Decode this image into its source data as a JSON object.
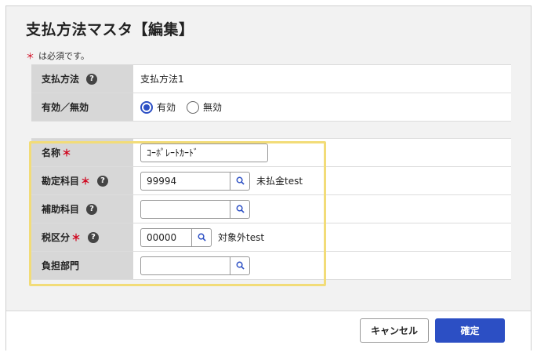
{
  "dialog": {
    "title": "支払方法マスタ【編集】",
    "required_note_star": "＊",
    "required_note_text": "は必須です。"
  },
  "basic": {
    "payment_method_label": "支払方法",
    "payment_method_value": "支払方法1",
    "active_label": "有効／無効",
    "active_options": [
      "有効",
      "無効"
    ],
    "active_selected": "有効"
  },
  "form": {
    "name_label": "名称",
    "name_value": "ｺｰﾎﾟﾚｰﾄｶｰﾄﾞ",
    "account_label": "勘定科目",
    "account_code": "99994",
    "account_name": "未払金test",
    "sub_account_label": "補助科目",
    "sub_account_value": "",
    "tax_label": "税区分",
    "tax_code": "00000",
    "tax_name": "対象外test",
    "department_label": "負担部門",
    "department_value": ""
  },
  "required_star": "＊",
  "help_glyph": "?",
  "icons": {
    "help": "question-circle-icon",
    "search": "search-icon"
  },
  "colors": {
    "accent": "#2c4fc4",
    "required": "#d0021b",
    "highlight": "#f2dc78"
  },
  "footer": {
    "cancel_label": "キャンセル",
    "confirm_label": "確定"
  }
}
